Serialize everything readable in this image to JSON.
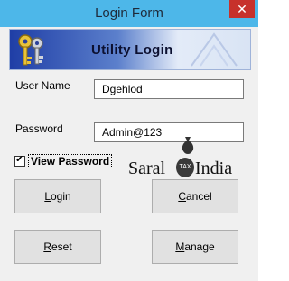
{
  "window": {
    "title": "Login Form",
    "close_glyph": "✕"
  },
  "banner": {
    "title": "Utility Login",
    "icon": "keys-icon"
  },
  "form": {
    "username_label": "User Name",
    "username_value": "Dgehlod",
    "password_label": "Password",
    "password_value": "Admin@123",
    "view_password_label": "View Password",
    "view_password_checked": true
  },
  "buttons": {
    "login": {
      "accel": "L",
      "rest": "ogin"
    },
    "cancel": {
      "accel": "C",
      "rest": "ancel"
    },
    "reset": {
      "accel": "R",
      "rest": "eset"
    },
    "manage": {
      "accel": "M",
      "rest": "anage"
    }
  },
  "logo": {
    "text_left": "Saral",
    "tax": "TAX",
    "text_right": "India"
  },
  "colors": {
    "titlebar": "#4db7e9",
    "close": "#c7312b",
    "banner_dark": "#1f3ea6"
  }
}
